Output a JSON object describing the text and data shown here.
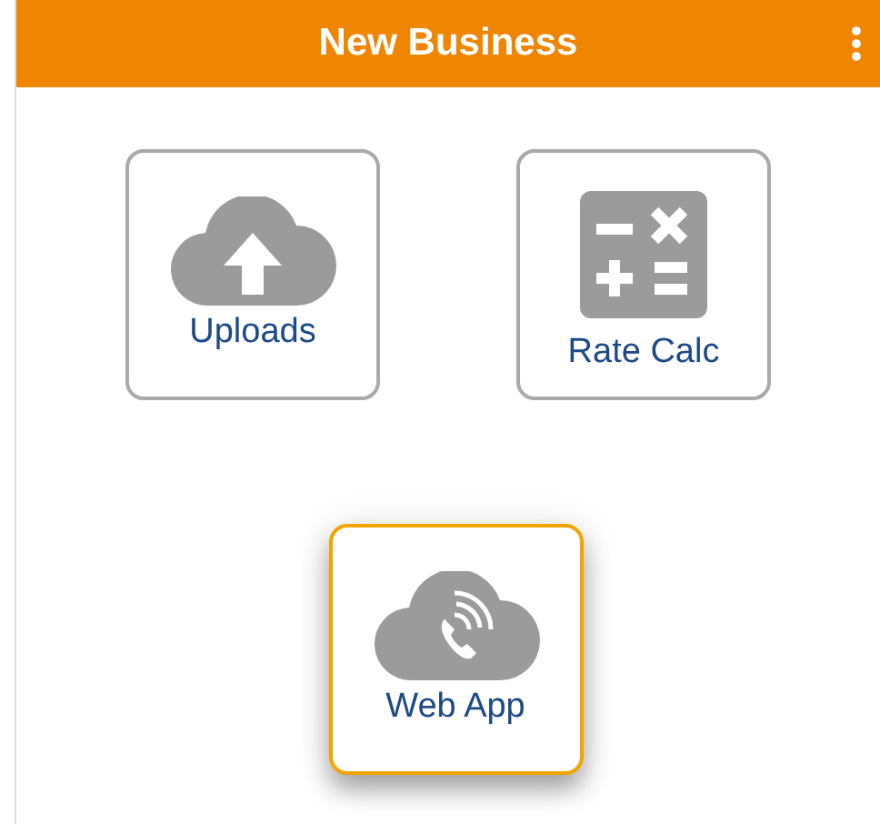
{
  "header": {
    "title": "New Business"
  },
  "tiles": [
    {
      "label": "Uploads",
      "kind": "upload",
      "selected": false
    },
    {
      "label": "Rate Calc",
      "kind": "calculator",
      "selected": false
    },
    {
      "label": "Web App",
      "kind": "phone-cloud",
      "selected": true
    }
  ]
}
